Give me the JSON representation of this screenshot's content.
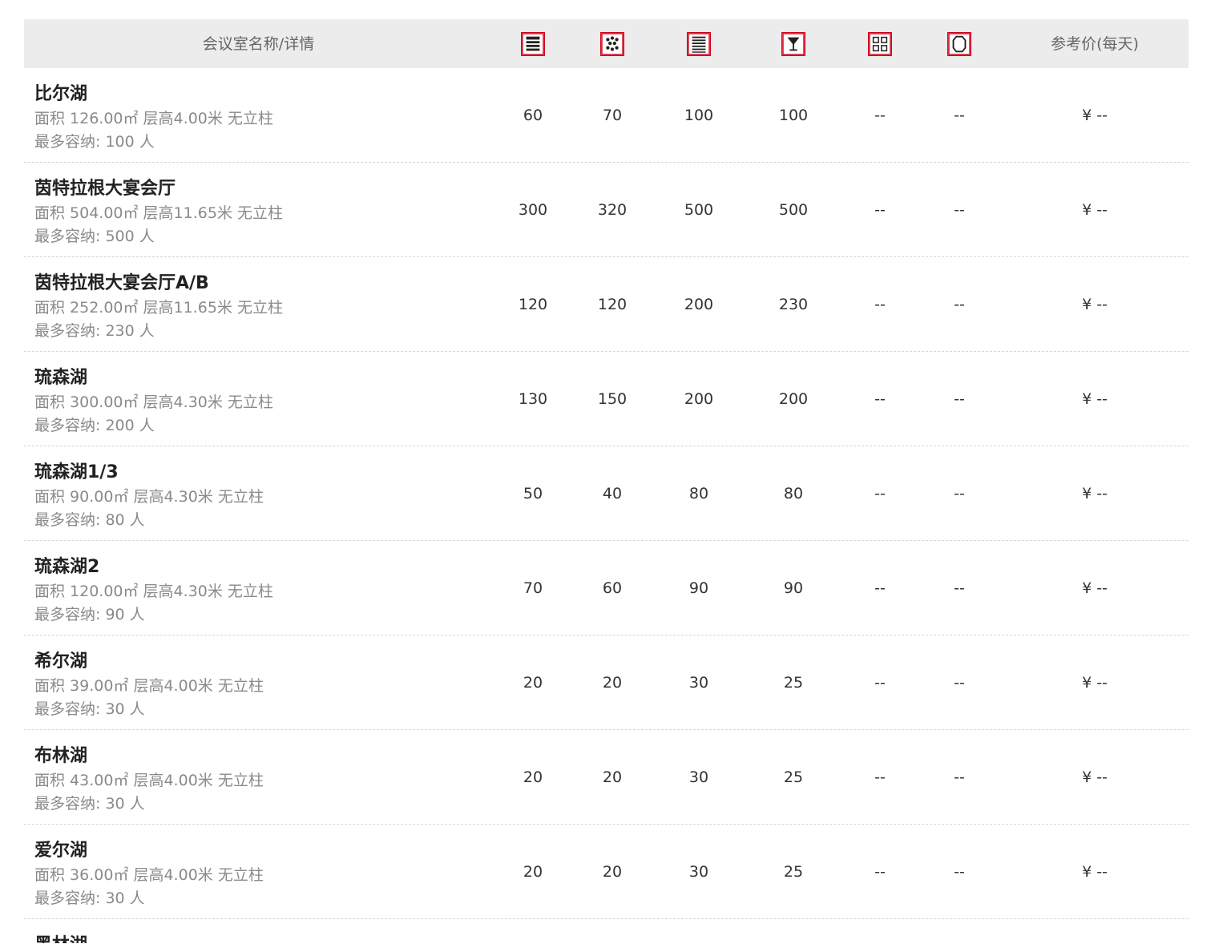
{
  "header": {
    "name_label": "会议室名称/详情",
    "price_label": "参考价(每天)",
    "layout_icons": [
      "theater-layout-icon",
      "banquet-layout-icon",
      "classroom-layout-icon",
      "cocktail-layout-icon",
      "square-layout-icon",
      "u-shape-layout-icon"
    ],
    "accent_color": "#d0021b"
  },
  "rooms": [
    {
      "name": "比尔湖",
      "area": "面积 126.00㎡ 层高4.00米 无立柱",
      "capacity": "最多容纳: 100 人",
      "v1": "60",
      "v2": "70",
      "v3": "100",
      "v4": "100",
      "v5": "--",
      "v6": "--",
      "price": "¥ --"
    },
    {
      "name": "茵特拉根大宴会厅",
      "area": "面积 504.00㎡ 层高11.65米 无立柱",
      "capacity": "最多容纳: 500 人",
      "v1": "300",
      "v2": "320",
      "v3": "500",
      "v4": "500",
      "v5": "--",
      "v6": "--",
      "price": "¥ --"
    },
    {
      "name": "茵特拉根大宴会厅A/B",
      "area": "面积 252.00㎡ 层高11.65米 无立柱",
      "capacity": "最多容纳: 230 人",
      "v1": "120",
      "v2": "120",
      "v3": "200",
      "v4": "230",
      "v5": "--",
      "v6": "--",
      "price": "¥ --"
    },
    {
      "name": "琉森湖",
      "area": "面积 300.00㎡ 层高4.30米 无立柱",
      "capacity": "最多容纳: 200 人",
      "v1": "130",
      "v2": "150",
      "v3": "200",
      "v4": "200",
      "v5": "--",
      "v6": "--",
      "price": "¥ --"
    },
    {
      "name": "琉森湖1/3",
      "area": "面积 90.00㎡ 层高4.30米 无立柱",
      "capacity": "最多容纳: 80 人",
      "v1": "50",
      "v2": "40",
      "v3": "80",
      "v4": "80",
      "v5": "--",
      "v6": "--",
      "price": "¥ --"
    },
    {
      "name": "琉森湖2",
      "area": "面积 120.00㎡ 层高4.30米 无立柱",
      "capacity": "最多容纳: 90 人",
      "v1": "70",
      "v2": "60",
      "v3": "90",
      "v4": "90",
      "v5": "--",
      "v6": "--",
      "price": "¥ --"
    },
    {
      "name": "希尔湖",
      "area": "面积 39.00㎡ 层高4.00米 无立柱",
      "capacity": "最多容纳: 30 人",
      "v1": "20",
      "v2": "20",
      "v3": "30",
      "v4": "25",
      "v5": "--",
      "v6": "--",
      "price": "¥ --"
    },
    {
      "name": "布林湖",
      "area": "面积 43.00㎡ 层高4.00米 无立柱",
      "capacity": "最多容纳: 30 人",
      "v1": "20",
      "v2": "20",
      "v3": "30",
      "v4": "25",
      "v5": "--",
      "v6": "--",
      "price": "¥ --"
    },
    {
      "name": "爱尔湖",
      "area": "面积 36.00㎡ 层高4.00米 无立柱",
      "capacity": "最多容纳: 30 人",
      "v1": "20",
      "v2": "20",
      "v3": "30",
      "v4": "25",
      "v5": "--",
      "v6": "--",
      "price": "¥ --"
    }
  ],
  "next_row_name": "黑林湖"
}
